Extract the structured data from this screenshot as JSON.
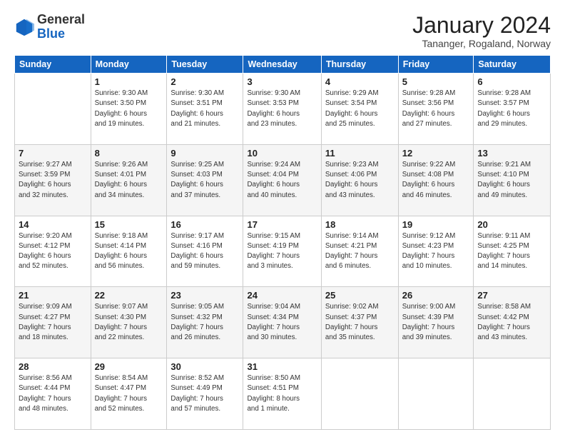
{
  "logo": {
    "general": "General",
    "blue": "Blue"
  },
  "header": {
    "month": "January 2024",
    "location": "Tananger, Rogaland, Norway"
  },
  "days_of_week": [
    "Sunday",
    "Monday",
    "Tuesday",
    "Wednesday",
    "Thursday",
    "Friday",
    "Saturday"
  ],
  "weeks": [
    [
      {
        "day": "",
        "info": ""
      },
      {
        "day": "1",
        "info": "Sunrise: 9:30 AM\nSunset: 3:50 PM\nDaylight: 6 hours\nand 19 minutes."
      },
      {
        "day": "2",
        "info": "Sunrise: 9:30 AM\nSunset: 3:51 PM\nDaylight: 6 hours\nand 21 minutes."
      },
      {
        "day": "3",
        "info": "Sunrise: 9:30 AM\nSunset: 3:53 PM\nDaylight: 6 hours\nand 23 minutes."
      },
      {
        "day": "4",
        "info": "Sunrise: 9:29 AM\nSunset: 3:54 PM\nDaylight: 6 hours\nand 25 minutes."
      },
      {
        "day": "5",
        "info": "Sunrise: 9:28 AM\nSunset: 3:56 PM\nDaylight: 6 hours\nand 27 minutes."
      },
      {
        "day": "6",
        "info": "Sunrise: 9:28 AM\nSunset: 3:57 PM\nDaylight: 6 hours\nand 29 minutes."
      }
    ],
    [
      {
        "day": "7",
        "info": "Sunrise: 9:27 AM\nSunset: 3:59 PM\nDaylight: 6 hours\nand 32 minutes."
      },
      {
        "day": "8",
        "info": "Sunrise: 9:26 AM\nSunset: 4:01 PM\nDaylight: 6 hours\nand 34 minutes."
      },
      {
        "day": "9",
        "info": "Sunrise: 9:25 AM\nSunset: 4:03 PM\nDaylight: 6 hours\nand 37 minutes."
      },
      {
        "day": "10",
        "info": "Sunrise: 9:24 AM\nSunset: 4:04 PM\nDaylight: 6 hours\nand 40 minutes."
      },
      {
        "day": "11",
        "info": "Sunrise: 9:23 AM\nSunset: 4:06 PM\nDaylight: 6 hours\nand 43 minutes."
      },
      {
        "day": "12",
        "info": "Sunrise: 9:22 AM\nSunset: 4:08 PM\nDaylight: 6 hours\nand 46 minutes."
      },
      {
        "day": "13",
        "info": "Sunrise: 9:21 AM\nSunset: 4:10 PM\nDaylight: 6 hours\nand 49 minutes."
      }
    ],
    [
      {
        "day": "14",
        "info": "Sunrise: 9:20 AM\nSunset: 4:12 PM\nDaylight: 6 hours\nand 52 minutes."
      },
      {
        "day": "15",
        "info": "Sunrise: 9:18 AM\nSunset: 4:14 PM\nDaylight: 6 hours\nand 56 minutes."
      },
      {
        "day": "16",
        "info": "Sunrise: 9:17 AM\nSunset: 4:16 PM\nDaylight: 6 hours\nand 59 minutes."
      },
      {
        "day": "17",
        "info": "Sunrise: 9:15 AM\nSunset: 4:19 PM\nDaylight: 7 hours\nand 3 minutes."
      },
      {
        "day": "18",
        "info": "Sunrise: 9:14 AM\nSunset: 4:21 PM\nDaylight: 7 hours\nand 6 minutes."
      },
      {
        "day": "19",
        "info": "Sunrise: 9:12 AM\nSunset: 4:23 PM\nDaylight: 7 hours\nand 10 minutes."
      },
      {
        "day": "20",
        "info": "Sunrise: 9:11 AM\nSunset: 4:25 PM\nDaylight: 7 hours\nand 14 minutes."
      }
    ],
    [
      {
        "day": "21",
        "info": "Sunrise: 9:09 AM\nSunset: 4:27 PM\nDaylight: 7 hours\nand 18 minutes."
      },
      {
        "day": "22",
        "info": "Sunrise: 9:07 AM\nSunset: 4:30 PM\nDaylight: 7 hours\nand 22 minutes."
      },
      {
        "day": "23",
        "info": "Sunrise: 9:05 AM\nSunset: 4:32 PM\nDaylight: 7 hours\nand 26 minutes."
      },
      {
        "day": "24",
        "info": "Sunrise: 9:04 AM\nSunset: 4:34 PM\nDaylight: 7 hours\nand 30 minutes."
      },
      {
        "day": "25",
        "info": "Sunrise: 9:02 AM\nSunset: 4:37 PM\nDaylight: 7 hours\nand 35 minutes."
      },
      {
        "day": "26",
        "info": "Sunrise: 9:00 AM\nSunset: 4:39 PM\nDaylight: 7 hours\nand 39 minutes."
      },
      {
        "day": "27",
        "info": "Sunrise: 8:58 AM\nSunset: 4:42 PM\nDaylight: 7 hours\nand 43 minutes."
      }
    ],
    [
      {
        "day": "28",
        "info": "Sunrise: 8:56 AM\nSunset: 4:44 PM\nDaylight: 7 hours\nand 48 minutes."
      },
      {
        "day": "29",
        "info": "Sunrise: 8:54 AM\nSunset: 4:47 PM\nDaylight: 7 hours\nand 52 minutes."
      },
      {
        "day": "30",
        "info": "Sunrise: 8:52 AM\nSunset: 4:49 PM\nDaylight: 7 hours\nand 57 minutes."
      },
      {
        "day": "31",
        "info": "Sunrise: 8:50 AM\nSunset: 4:51 PM\nDaylight: 8 hours\nand 1 minute."
      },
      {
        "day": "",
        "info": ""
      },
      {
        "day": "",
        "info": ""
      },
      {
        "day": "",
        "info": ""
      }
    ]
  ]
}
